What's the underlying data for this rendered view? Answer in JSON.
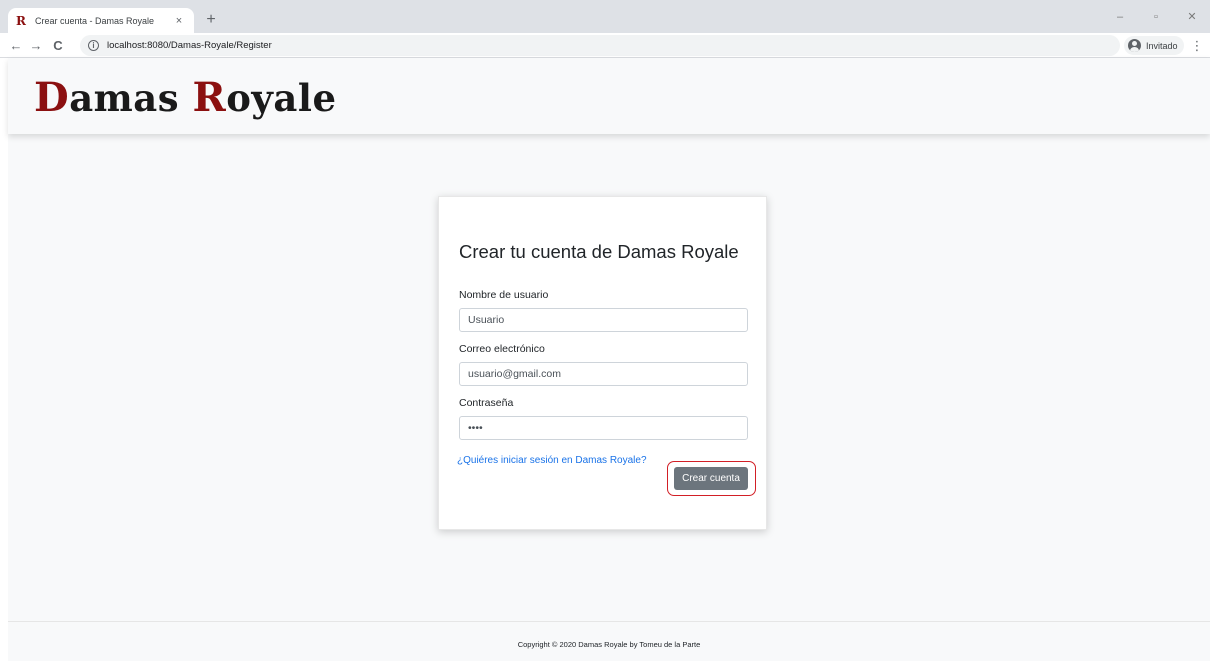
{
  "browser": {
    "tab_title": "Crear cuenta - Damas Royale",
    "tab_close": "×",
    "new_tab": "+",
    "url": "localhost:8080/Damas-Royale/Register",
    "profile_label": "Invitado",
    "menu": "⋮",
    "back": "←",
    "forward": "→",
    "reload": "C",
    "info": "i",
    "window_minimize": "–",
    "window_restore": "▫",
    "window_close": "✕",
    "favicon": "R"
  },
  "header": {
    "logo_first_cap": "D",
    "logo_first_rest": "amas ",
    "logo_second_cap": "R",
    "logo_second_rest": "oyale"
  },
  "register_form": {
    "title": "Crear tu cuenta de Damas Royale",
    "username_label": "Nombre de usuario",
    "username_value": "Usuario",
    "email_label": "Correo electrónico",
    "email_value": "usuario@gmail.com",
    "password_label": "Contraseña",
    "password_value": "••••",
    "login_link": "¿Quiéres iniciar sesión en Damas Royale?",
    "submit_label": "Crear cuenta"
  },
  "footer": {
    "copyright": "Copyright © 2020 Damas Royale by Tomeu de la Parte"
  },
  "colors": {
    "brand_red": "#8b1010",
    "link": "#1a73e8",
    "button": "#6c757d",
    "highlight_outline": "#d21f26"
  }
}
